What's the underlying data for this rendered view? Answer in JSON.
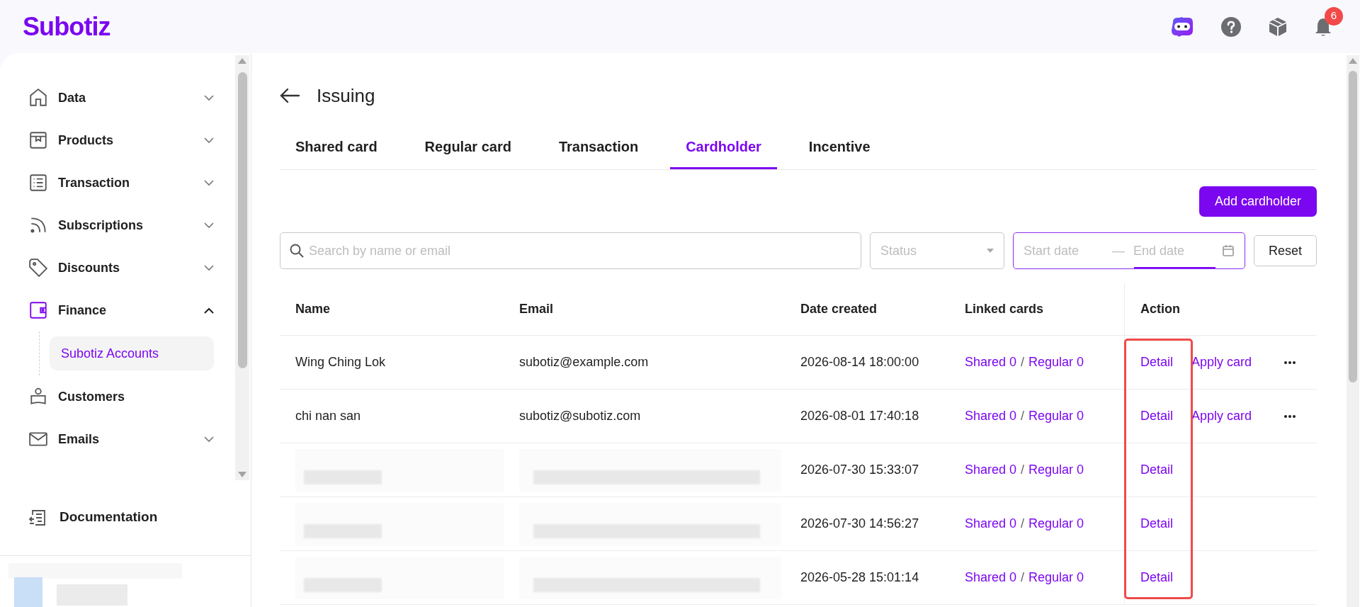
{
  "logo": "Subotiz",
  "header": {
    "notifications": "6"
  },
  "sidebar": {
    "items": [
      {
        "label": "Data",
        "kind": "group",
        "expanded": false,
        "selected": false
      },
      {
        "label": "Products",
        "kind": "group",
        "expanded": false,
        "selected": false
      },
      {
        "label": "Transaction",
        "kind": "group",
        "expanded": false,
        "selected": false
      },
      {
        "label": "Subscriptions",
        "kind": "group",
        "expanded": false,
        "selected": false
      },
      {
        "label": "Discounts",
        "kind": "group",
        "expanded": false,
        "selected": false
      },
      {
        "label": "Finance",
        "kind": "group",
        "expanded": true,
        "selected": true,
        "children": [
          {
            "label": "Subotiz Accounts",
            "selected": true
          }
        ]
      },
      {
        "label": "Customers",
        "kind": "link",
        "selected": false
      },
      {
        "label": "Emails",
        "kind": "group",
        "expanded": false,
        "selected": false
      }
    ],
    "footer_item": "Documentation"
  },
  "page": {
    "title": "Issuing"
  },
  "tabs": [
    {
      "label": "Shared card",
      "selected": false
    },
    {
      "label": "Regular card",
      "selected": false
    },
    {
      "label": "Transaction",
      "selected": false
    },
    {
      "label": "Cardholder",
      "selected": true
    },
    {
      "label": "Incentive",
      "selected": false
    }
  ],
  "add_button": "Add cardholder",
  "filters": {
    "search_placeholder": "Search by name or email",
    "status_placeholder": "Status",
    "start_placeholder": "Start date",
    "range_separator": "—",
    "end_placeholder": "End date",
    "reset": "Reset"
  },
  "table": {
    "columns": [
      {
        "label": "Name",
        "highlighted": false
      },
      {
        "label": "Email",
        "highlighted": false
      },
      {
        "label": "Date created",
        "highlighted": false
      },
      {
        "label": "Linked cards",
        "highlighted": false
      },
      {
        "label": "Action",
        "highlighted": true
      }
    ],
    "rows": [
      {
        "kind": "plain",
        "name": "Wing Ching Lok",
        "email": "subotiz@example.com",
        "date": "2026-08-14 18:00:00",
        "shared": "Shared 0",
        "sep": "/",
        "regular": "Regular 0",
        "actions": [
          "Detail",
          "Apply card"
        ],
        "more": true
      },
      {
        "kind": "plain",
        "name": "chi nan san",
        "email": "subotiz@subotiz.com",
        "date": "2026-08-01 17:40:18",
        "shared": "Shared 0",
        "sep": "/",
        "regular": "Regular 0",
        "actions": [
          "Detail",
          "Apply card"
        ],
        "more": true
      },
      {
        "kind": "redacted",
        "date": "2026-07-30 15:33:07",
        "shared": "Shared 0",
        "sep": "/",
        "regular": "Regular 0",
        "actions": [
          "Detail"
        ],
        "more": false
      },
      {
        "kind": "redacted",
        "date": "2026-07-30 14:56:27",
        "shared": "Shared 0",
        "sep": "/",
        "regular": "Regular 0",
        "actions": [
          "Detail"
        ],
        "more": false
      },
      {
        "kind": "redacted",
        "date": "2026-05-28 15:01:14",
        "shared": "Shared 0",
        "sep": "/",
        "regular": "Regular 0",
        "actions": [
          "Detail"
        ],
        "more": false
      }
    ]
  }
}
